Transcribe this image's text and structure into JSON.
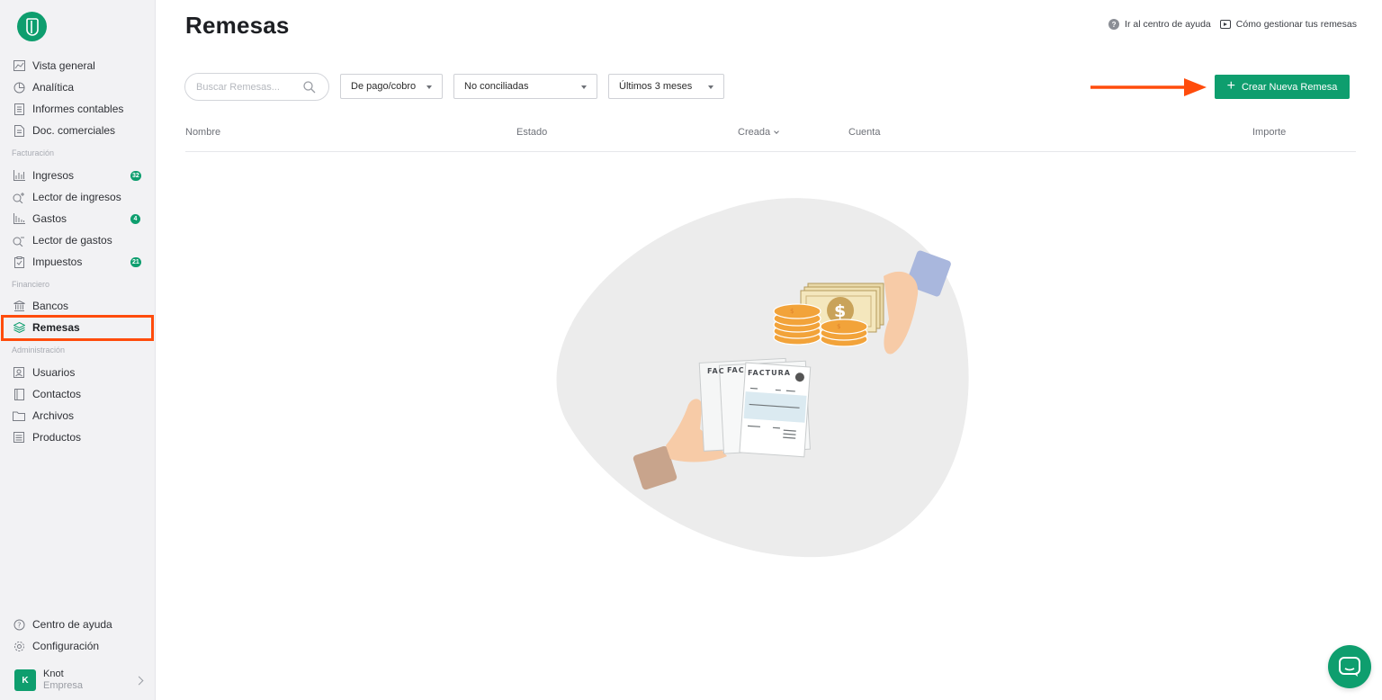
{
  "brand": {
    "accent": "#0e9e6e",
    "highlight": "#ff4c0c"
  },
  "sidebar": {
    "main_items": [
      {
        "label": "Vista general",
        "icon": "chart-area-icon"
      },
      {
        "label": "Analítica",
        "icon": "pie-icon"
      },
      {
        "label": "Informes contables",
        "icon": "ledger-icon"
      },
      {
        "label": "Doc. comerciales",
        "icon": "document-icon"
      }
    ],
    "sections": {
      "facturacion": "Facturación",
      "financiero": "Financiero",
      "administracion": "Administración"
    },
    "facturacion_items": [
      {
        "label": "Ingresos",
        "icon": "bar-chart-icon",
        "badge": "32"
      },
      {
        "label": "Lector de ingresos",
        "icon": "search-plus-icon"
      },
      {
        "label": "Gastos",
        "icon": "bar-chart-down-icon",
        "badge": "4"
      },
      {
        "label": "Lector de gastos",
        "icon": "search-minus-icon"
      },
      {
        "label": "Impuestos",
        "icon": "clipboard-icon",
        "badge": "21"
      }
    ],
    "financiero_items": [
      {
        "label": "Bancos",
        "icon": "bank-icon"
      },
      {
        "label": "Remesas",
        "icon": "layers-icon",
        "active": true
      }
    ],
    "admin_items": [
      {
        "label": "Usuarios",
        "icon": "user-card-icon"
      },
      {
        "label": "Contactos",
        "icon": "address-book-icon"
      },
      {
        "label": "Archivos",
        "icon": "folder-icon"
      },
      {
        "label": "Productos",
        "icon": "box-list-icon"
      }
    ],
    "bottom_items": [
      {
        "label": "Centro de ayuda",
        "icon": "help-icon"
      },
      {
        "label": "Configuración",
        "icon": "gear-icon"
      }
    ],
    "user": {
      "initial": "K",
      "name": "Knot",
      "company": "Empresa"
    }
  },
  "header": {
    "title": "Remesas",
    "help_link": "Ir al centro de ayuda",
    "video_link": "Cómo gestionar tus remesas"
  },
  "filters": {
    "search_placeholder": "Buscar Remesas...",
    "type": "De pago/cobro",
    "status": "No conciliadas",
    "period": "Últimos 3 meses"
  },
  "actions": {
    "create_label": "Crear Nueva Remesa"
  },
  "table": {
    "columns": [
      "Nombre",
      "Estado",
      "Creada",
      "Cuenta",
      "Importe"
    ]
  },
  "illustration": {
    "invoice_label": "FACTURA",
    "invoice_partial": "FAC",
    "currency_symbol": "$"
  }
}
